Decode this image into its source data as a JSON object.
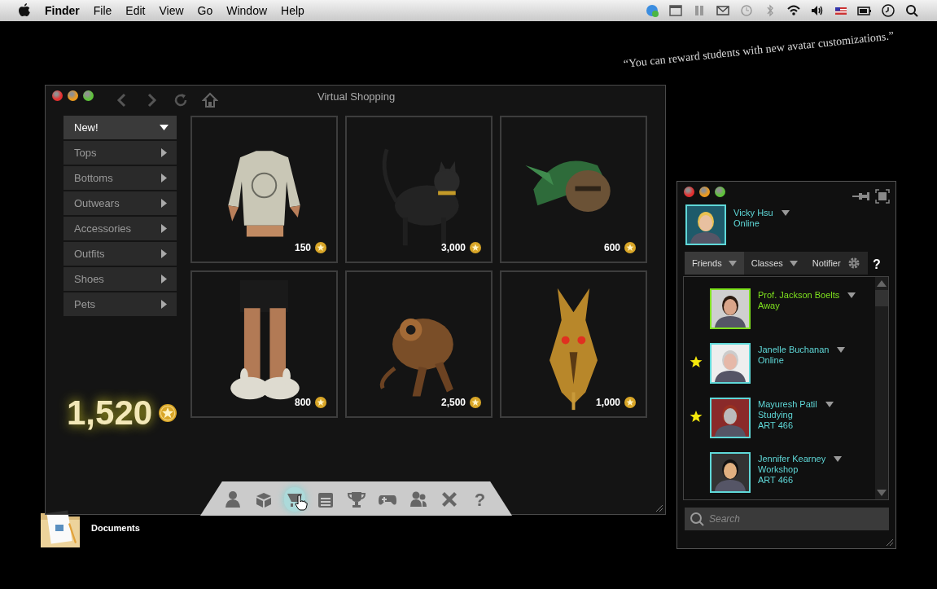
{
  "menubar": {
    "app": "Finder",
    "menus": [
      "File",
      "Edit",
      "View",
      "Go",
      "Window",
      "Help"
    ]
  },
  "desktop": {
    "icons": [
      {
        "label": "Documents"
      }
    ]
  },
  "quote": "“You can reward students with new avatar customizations.”",
  "shop": {
    "title": "Virtual Shopping",
    "categories": [
      {
        "label": "New!",
        "expanded": true
      },
      {
        "label": "Tops",
        "expanded": false
      },
      {
        "label": "Bottoms",
        "expanded": false
      },
      {
        "label": "Outwears",
        "expanded": false
      },
      {
        "label": "Accessories",
        "expanded": false
      },
      {
        "label": "Outfits",
        "expanded": false
      },
      {
        "label": "Shoes",
        "expanded": false
      },
      {
        "label": "Pets",
        "expanded": false
      }
    ],
    "items": [
      {
        "price": "150"
      },
      {
        "price": "3,000"
      },
      {
        "price": "600"
      },
      {
        "price": "800"
      },
      {
        "price": "2,500"
      },
      {
        "price": "1,000"
      }
    ],
    "balance": "1,520",
    "toolbar": [
      {
        "kind": "profile",
        "selected": false
      },
      {
        "kind": "box",
        "selected": false
      },
      {
        "kind": "shop",
        "selected": true
      },
      {
        "kind": "calendar",
        "selected": false
      },
      {
        "kind": "trophy",
        "selected": false
      },
      {
        "kind": "game",
        "selected": false
      },
      {
        "kind": "friends",
        "selected": false
      },
      {
        "kind": "tools",
        "selected": false
      },
      {
        "kind": "help",
        "selected": false,
        "label": "?"
      }
    ]
  },
  "messenger": {
    "user": {
      "name": "Vicky Hsu",
      "status": "Online"
    },
    "tabs": [
      {
        "label": "Friends",
        "selected": true
      },
      {
        "label": "Classes",
        "selected": false
      },
      {
        "label": "Notifier",
        "selected": false
      }
    ],
    "help": "?",
    "friends": [
      {
        "name": "Prof. Jackson Boelts",
        "status": "Away",
        "favorite": false,
        "color": "#7ee01e"
      },
      {
        "name": "Janelle Buchanan",
        "status": "Online",
        "favorite": true,
        "color": "#5fd8d8"
      },
      {
        "name": "Mayuresh Patil",
        "status": "Studying",
        "course": "ART 466",
        "favorite": true,
        "color": "#5fd8d8"
      },
      {
        "name": "Jennifer Kearney",
        "status": "Workshop",
        "course": "ART 466",
        "favorite": false,
        "color": "#5fd8d8"
      }
    ],
    "search": {
      "placeholder": "Search"
    }
  }
}
